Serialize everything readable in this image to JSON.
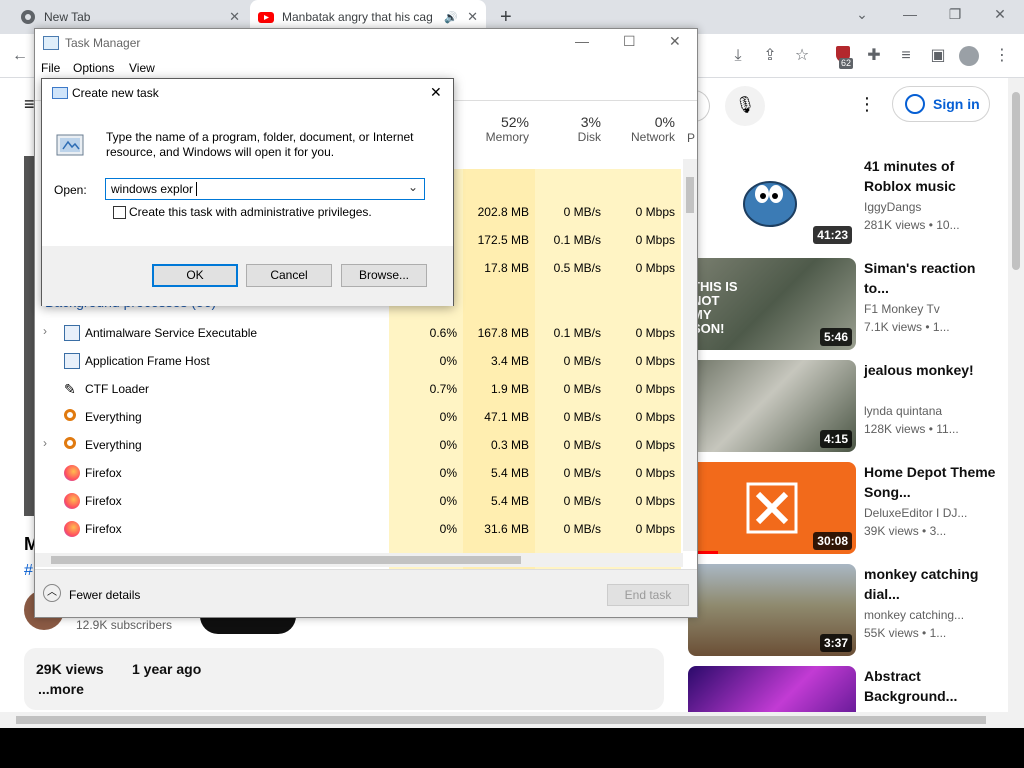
{
  "browser": {
    "tabs": [
      {
        "title": "New Tab"
      },
      {
        "title": "Manbatak angry that his cag"
      }
    ],
    "extension_badge": "62"
  },
  "youtube": {
    "signin": "Sign in",
    "video": {
      "title_fragment": "M",
      "hashtag_fragment": "#",
      "subscribers": "12.9K subscribers",
      "views": "29K views",
      "age": "1 year ago",
      "more": "...more"
    },
    "recommendations": [
      {
        "title": "41 minutes of Roblox music",
        "channel": "IggyDangs",
        "views": "281K views",
        "age": "• 10...",
        "duration": "41:23"
      },
      {
        "title": "Siman's reaction to...",
        "channel": "F1 Monkey Tv",
        "views": "7.1K views",
        "age": "• 1...",
        "duration": "5:46",
        "overlay": "THIS IS NOT MY SON!"
      },
      {
        "title": "jealous monkey!",
        "channel": "lynda quintana",
        "views": "128K views",
        "age": "• 11...",
        "duration": "4:15"
      },
      {
        "title": "Home Depot Theme Song...",
        "channel": "DeluxeEditor I DJ...",
        "views": "39K views",
        "age": "• 3...",
        "duration": "30:08"
      },
      {
        "title": "monkey catching dial...",
        "channel": "monkey catching...",
        "views": "55K views",
        "age": "• 1...",
        "duration": "3:37"
      },
      {
        "title": "Abstract Background...",
        "channel": "",
        "views": "",
        "age": "",
        "duration": ""
      }
    ]
  },
  "task_manager": {
    "title": "Task Manager",
    "menu": [
      "File",
      "Options",
      "View"
    ],
    "columns": [
      {
        "pct": "52%",
        "label": "Memory"
      },
      {
        "pct": "3%",
        "label": "Disk"
      },
      {
        "pct": "0%",
        "label": "Network"
      },
      {
        "pct": "",
        "label": "P"
      }
    ],
    "section_header": "Background processes (56)",
    "app_rows": [
      {
        "mem": "202.8 MB",
        "disk": "0 MB/s",
        "net": "0 Mbps"
      },
      {
        "mem": "172.5 MB",
        "disk": "0.1 MB/s",
        "net": "0 Mbps"
      },
      {
        "mem": "17.8 MB",
        "disk": "0.5 MB/s",
        "net": "0 Mbps"
      }
    ],
    "processes": [
      {
        "name": "Antimalware Service Executable",
        "cpu": "0.6%",
        "mem": "167.8 MB",
        "disk": "0.1 MB/s",
        "net": "0 Mbps",
        "icon": "shield-window-icon",
        "expandable": true
      },
      {
        "name": "Application Frame Host",
        "cpu": "0%",
        "mem": "3.4 MB",
        "disk": "0 MB/s",
        "net": "0 Mbps",
        "icon": "window-icon",
        "expandable": false
      },
      {
        "name": "CTF Loader",
        "cpu": "0.7%",
        "mem": "1.9 MB",
        "disk": "0 MB/s",
        "net": "0 Mbps",
        "icon": "pen-icon",
        "expandable": false
      },
      {
        "name": "Everything",
        "cpu": "0%",
        "mem": "47.1 MB",
        "disk": "0 MB/s",
        "net": "0 Mbps",
        "icon": "magnifier-icon",
        "expandable": false
      },
      {
        "name": "Everything",
        "cpu": "0%",
        "mem": "0.3 MB",
        "disk": "0 MB/s",
        "net": "0 Mbps",
        "icon": "magnifier-icon",
        "expandable": true
      },
      {
        "name": "Firefox",
        "cpu": "0%",
        "mem": "5.4 MB",
        "disk": "0 MB/s",
        "net": "0 Mbps",
        "icon": "firefox-icon",
        "expandable": false
      },
      {
        "name": "Firefox",
        "cpu": "0%",
        "mem": "5.4 MB",
        "disk": "0 MB/s",
        "net": "0 Mbps",
        "icon": "firefox-icon",
        "expandable": false
      },
      {
        "name": "Firefox",
        "cpu": "0%",
        "mem": "31.6 MB",
        "disk": "0 MB/s",
        "net": "0 Mbps",
        "icon": "firefox-icon",
        "expandable": false
      }
    ],
    "fewer_details": "Fewer details",
    "end_task": "End task"
  },
  "run_dialog": {
    "title": "Create new task",
    "description": "Type the name of a program, folder, document, or Internet resource, and Windows will open it for you.",
    "open_label": "Open:",
    "open_value": "windows explor",
    "admin_label": "Create this task with administrative privileges.",
    "ok": "OK",
    "cancel": "Cancel",
    "browse": "Browse..."
  }
}
